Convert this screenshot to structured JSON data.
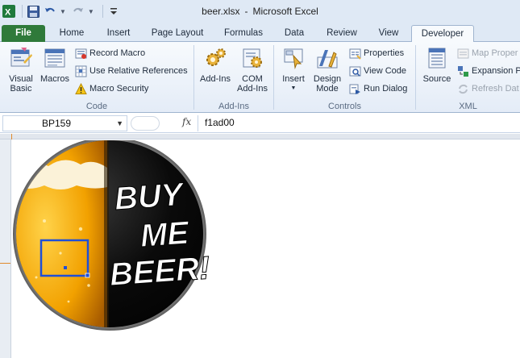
{
  "title_bar": {
    "filename": "beer.xlsx",
    "separator": "-",
    "app_name": "Microsoft Excel"
  },
  "tabs": [
    {
      "label": "File",
      "active": false
    },
    {
      "label": "Home",
      "active": false
    },
    {
      "label": "Insert",
      "active": false
    },
    {
      "label": "Page Layout",
      "active": false
    },
    {
      "label": "Formulas",
      "active": false
    },
    {
      "label": "Data",
      "active": false
    },
    {
      "label": "Review",
      "active": false
    },
    {
      "label": "View",
      "active": false
    },
    {
      "label": "Developer",
      "active": true
    }
  ],
  "ribbon": {
    "code": {
      "group_label": "Code",
      "visual_basic": "Visual Basic",
      "visual_basic_line1": "Visual",
      "visual_basic_line2": "Basic",
      "macros": "Macros",
      "record_macro": "Record Macro",
      "use_relative_references": "Use Relative References",
      "macro_security": "Macro Security"
    },
    "addins": {
      "group_label": "Add-Ins",
      "addins_button": "Add-Ins",
      "com_addins_line1": "COM",
      "com_addins_line2": "Add-Ins"
    },
    "controls": {
      "group_label": "Controls",
      "insert": "Insert",
      "design_mode_line1": "Design",
      "design_mode_line2": "Mode",
      "properties": "Properties",
      "view_code": "View Code",
      "run_dialog": "Run Dialog"
    },
    "xml": {
      "group_label": "XML",
      "source": "Source",
      "map_properties": "Map Proper",
      "expansion_packs": "Expansion P",
      "refresh_data": "Refresh Dat"
    }
  },
  "formula_bar": {
    "name_box": "BP159",
    "fx_label": "fx",
    "formula": "f1ad00"
  },
  "image": {
    "line1": "BUY",
    "line2": "ME",
    "line3": "BEER!"
  },
  "colors": {
    "file_tab": "#2f7a3a",
    "selection_box": "#1f4fd6",
    "badge_black": "#0a0a0a",
    "beer_gold": "#f2a100"
  }
}
